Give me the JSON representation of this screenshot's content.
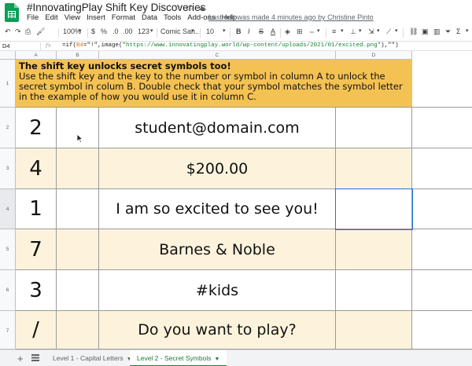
{
  "header": {
    "title": "#InnovatingPlay Shift Key Discoveries",
    "last_edit": "Last edit was made 4 minutes ago by Christine Pinto",
    "icons": [
      "star-icon",
      "folder-move-icon",
      "cloud-status-icon"
    ]
  },
  "menu": [
    "File",
    "Edit",
    "View",
    "Insert",
    "Format",
    "Data",
    "Tools",
    "Add-ons",
    "Help"
  ],
  "toolbar": {
    "zoom": "100%",
    "currency": "$",
    "percent": "%",
    "decimal_less": ".0",
    "decimal_more": ".00",
    "number_format": "123",
    "font": "Comic San...",
    "font_size": "10",
    "bold": "B",
    "italic": "I",
    "strike": "S",
    "text_color": "A"
  },
  "formula_bar": {
    "name_box": "D4",
    "fx": "fx",
    "formula_prefix": "=if(",
    "formula_ref": "B4",
    "formula_mid": "=\"!\",image(",
    "formula_url": "\"https://www.innovatingplay.world/wp-content/uploads/2021/01/excited.png\"",
    "formula_suffix": "),\"\")"
  },
  "columns": [
    "A",
    "B",
    "C",
    "D"
  ],
  "rows": [
    "1",
    "2",
    "3",
    "4",
    "5",
    "6",
    "7"
  ],
  "instructions": {
    "heading": "The shift key unlocks secret symbols too!",
    "body": "Use the shift key and the key to the number or symbol in column A to unlock the secret symbol in colum B. Double check that your symbol matches the symbol letter in the example of how you would use it in column C."
  },
  "table": [
    {
      "a": "2",
      "b": "",
      "c": "student@domain.com",
      "d": ""
    },
    {
      "a": "4",
      "b": "",
      "c": "$200.00",
      "d": ""
    },
    {
      "a": "1",
      "b": "",
      "c": "I am so excited to see you!",
      "d": ""
    },
    {
      "a": "7",
      "b": "",
      "c": "Barnes & Noble",
      "d": ""
    },
    {
      "a": "3",
      "b": "",
      "c": "#kids",
      "d": ""
    },
    {
      "a": "/",
      "b": "",
      "c": "Do you want to play?",
      "d": ""
    }
  ],
  "colors": {
    "instruction_bg": "#f4c253",
    "row_odd_bg": "#ffffff",
    "row_even_bg": "#fdf3dc",
    "selection": "#1a73e8",
    "active_tab": "#188038"
  },
  "sheets": [
    {
      "label": "Level 1 - Capital Letters",
      "active": false
    },
    {
      "label": "Level 2 - Secret Symbols",
      "active": true
    }
  ],
  "tab_controls": {
    "add": "+",
    "list_icon": "sheet-list-icon"
  }
}
